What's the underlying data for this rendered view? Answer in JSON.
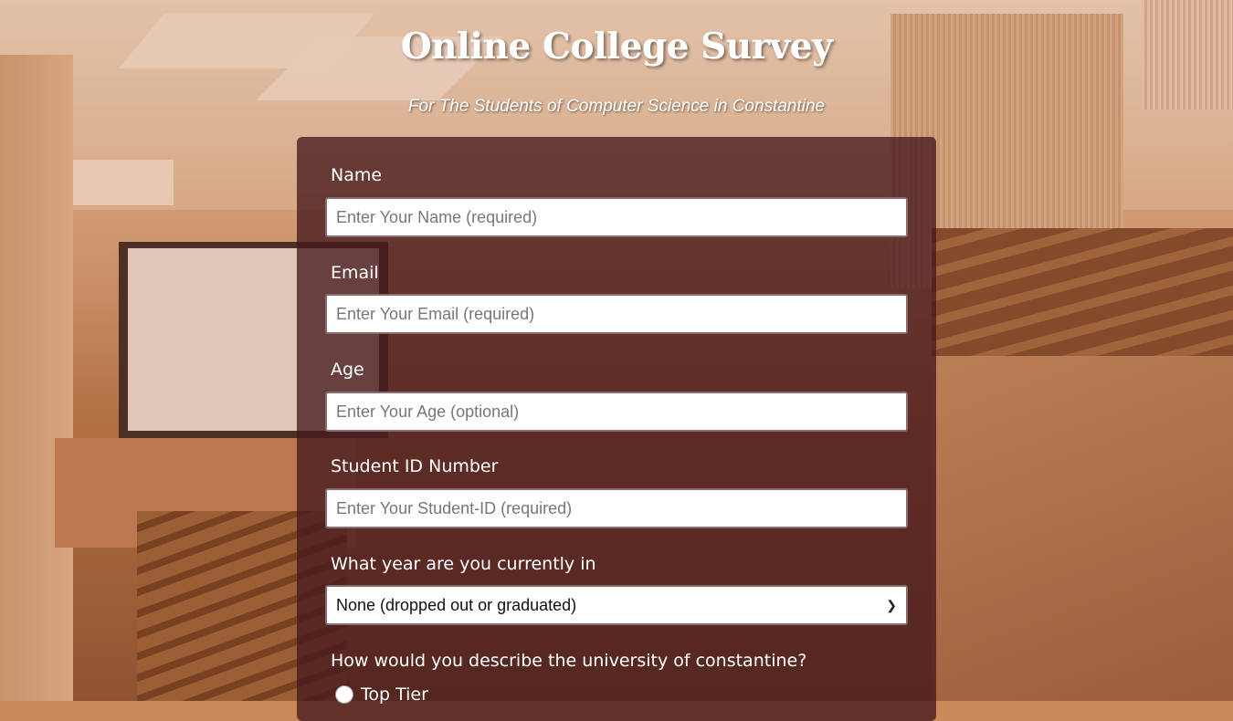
{
  "header": {
    "title": "Online College Survey",
    "subtitle": "For The Students of Computer Science in Constantine"
  },
  "form": {
    "name": {
      "label": "Name",
      "placeholder": "Enter Your Name (required)"
    },
    "email": {
      "label": "Email",
      "placeholder": "Enter Your Email (required)"
    },
    "age": {
      "label": "Age",
      "placeholder": "Enter Your Age (optional)"
    },
    "student_id": {
      "label": "Student ID Number",
      "placeholder": "Enter Your Student-ID (required)"
    },
    "year": {
      "label": "What year are you currently in",
      "selected": "None (dropped out or graduated)"
    },
    "university": {
      "question": "How would you describe the university of constantine?",
      "options": [
        "Top Tier"
      ]
    }
  },
  "colors": {
    "card_background": "#46191e",
    "text": "#ffffff"
  }
}
